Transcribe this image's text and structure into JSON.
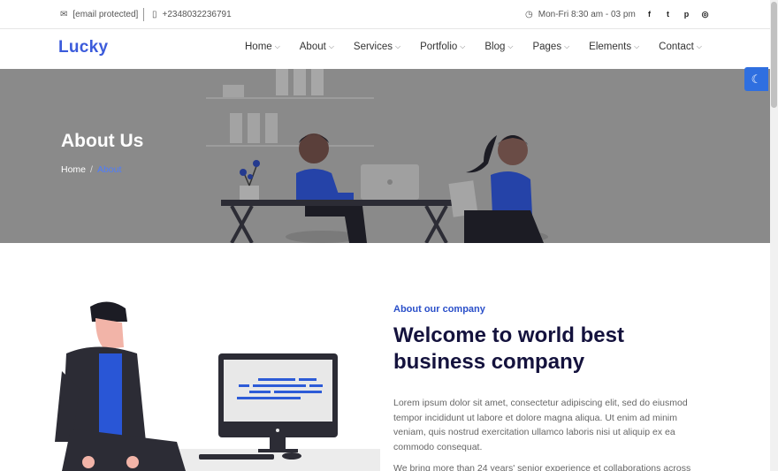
{
  "topbar": {
    "email": "[email protected]",
    "phone": "+2348032236791",
    "hours": "Mon-Fri 8:30 am - 03 pm",
    "social": [
      {
        "icon": "facebook-icon",
        "glyph": "f"
      },
      {
        "icon": "twitter-icon",
        "glyph": "t"
      },
      {
        "icon": "pinterest-icon",
        "glyph": "p"
      },
      {
        "icon": "instagram-icon",
        "glyph": "◎"
      }
    ]
  },
  "nav": {
    "logo": "Lucky",
    "items": [
      "Home",
      "About",
      "Services",
      "Portfolio",
      "Blog",
      "Pages",
      "Elements",
      "Contact"
    ]
  },
  "hero": {
    "title": "About Us",
    "breadcrumb_home": "Home",
    "breadcrumb_sep": "/",
    "breadcrumb_current": "About"
  },
  "about": {
    "eyebrow": "About our company",
    "heading": "Welcome to world best business company",
    "paragraph": "Lorem ipsum dolor sit amet, consectetur adipiscing elit, sed do eiusmod tempor incididunt ut labore et dolore magna aliqua. Ut enim ad minim veniam, quis nostrud exercitation ullamco laboris nisi ut aliquip ex ea commodo consequat.",
    "paragraph2": "We bring more than 24 years' senior experience et collaborations across"
  },
  "colors": {
    "accent": "#2f6fe0",
    "brand": "#3b5bdb",
    "heading": "#14123d",
    "hero_bg": "#8a8a8a"
  }
}
